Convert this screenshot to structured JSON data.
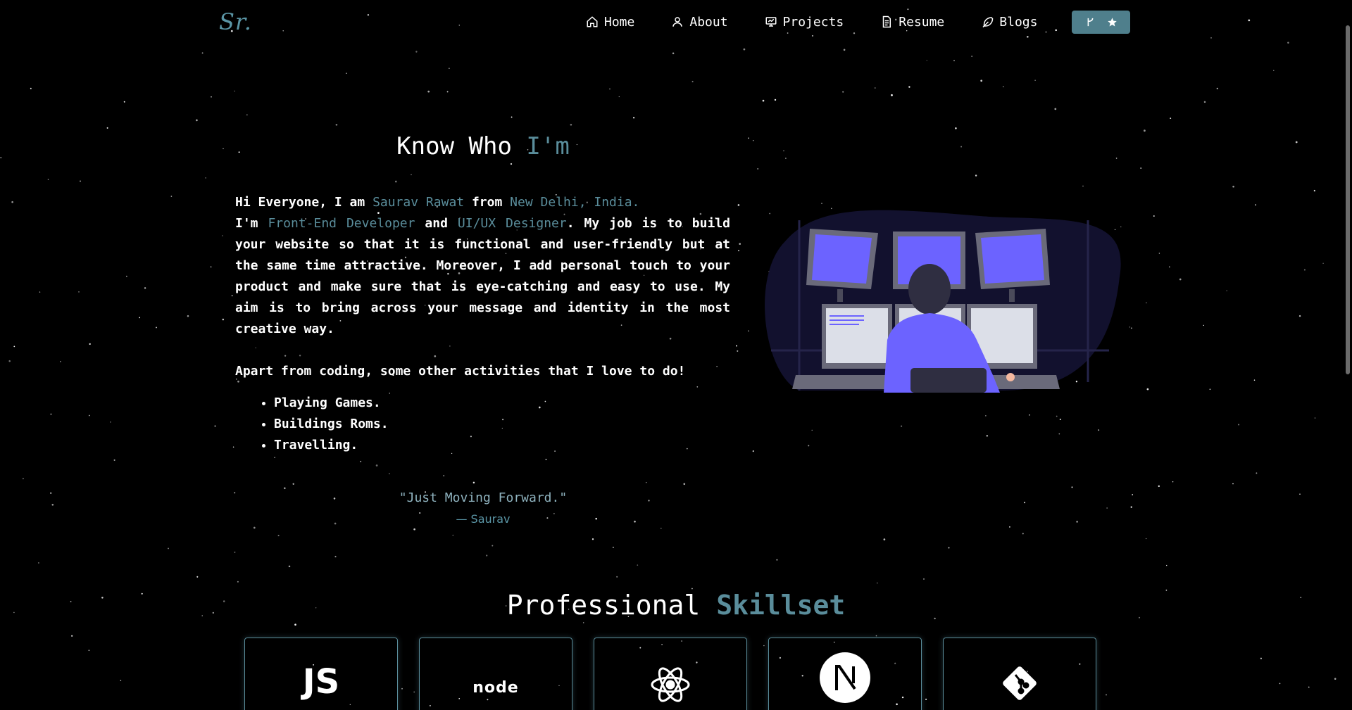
{
  "brand": {
    "logo_text": "Sr."
  },
  "nav": {
    "items": [
      {
        "label": "Home",
        "icon": "home-icon"
      },
      {
        "label": "About",
        "icon": "user-icon"
      },
      {
        "label": "Projects",
        "icon": "presentation-icon"
      },
      {
        "label": "Resume",
        "icon": "document-icon"
      },
      {
        "label": "Blogs",
        "icon": "feather-icon"
      }
    ],
    "github_button": {
      "icons": [
        "fork-icon",
        "star-icon"
      ]
    }
  },
  "about": {
    "title_prefix": "Know Who ",
    "title_accent": "I'm",
    "intro_1": "Hi Everyone, I am ",
    "name": "Saurav Rawat",
    "from": " from ",
    "location": "New Delhi, India.",
    "im": "I'm ",
    "role_1": "Front-End Developer",
    "and": " and ",
    "role_2": "UI/UX Designer",
    "body": ". My job is to build your website so that it is functional and user-friendly but at the same time attractive. Moreover, I add personal touch to your product and make sure that is eye-catching and easy to use. My aim is to bring across your message and identity in the most creative way.",
    "activities_intro": "Apart from coding, some other activities that I love to do!",
    "activities": [
      "Playing Games.",
      "Buildings Roms.",
      "Travelling."
    ],
    "quote": "\"Just Moving Forward.\"",
    "quote_author": "— Saurav"
  },
  "skills": {
    "title_prefix": "Professional ",
    "title_accent": "Skillset",
    "items": [
      {
        "label": "JS",
        "icon": "javascript-icon"
      },
      {
        "label": "node",
        "icon": "nodejs-icon"
      },
      {
        "label": "",
        "icon": "react-icon"
      },
      {
        "label": "",
        "icon": "nextjs-icon"
      },
      {
        "label": "",
        "icon": "git-icon"
      }
    ]
  },
  "colors": {
    "accent": "#5a8d9b",
    "background": "#000000",
    "button": "#4f7f8c"
  }
}
